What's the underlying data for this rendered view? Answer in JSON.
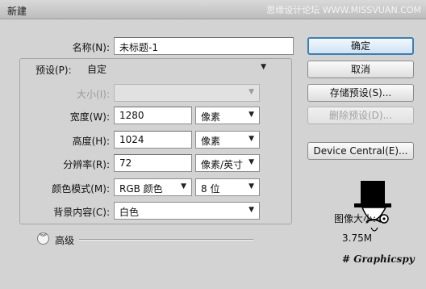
{
  "window": {
    "title": "新建",
    "watermark": "思缘设计论坛  WWW.MISSVUAN.COM"
  },
  "form": {
    "name": {
      "label": "名称(N):",
      "value": "未标题-1"
    },
    "preset": {
      "label": "预设(P):",
      "value": "自定"
    },
    "size": {
      "label": "大小(I):",
      "value": ""
    },
    "width": {
      "label": "宽度(W):",
      "value": "1280",
      "unit": "像素"
    },
    "height": {
      "label": "高度(H):",
      "value": "1024",
      "unit": "像素"
    },
    "resolution": {
      "label": "分辨率(R):",
      "value": "72",
      "unit": "像素/英寸"
    },
    "color_mode": {
      "label": "颜色模式(M):",
      "value": "RGB 颜色",
      "depth": "8 位"
    },
    "background": {
      "label": "背景内容(C):",
      "value": "白色"
    },
    "advanced_label": "高级"
  },
  "buttons": {
    "ok": "确定",
    "cancel": "取消",
    "save_preset": "存储预设(S)...",
    "delete_preset": "删除预设(D)...",
    "device_central": "Device Central(E)..."
  },
  "image_size": {
    "label": "图像大小:",
    "value": "3.75M"
  },
  "brand_text": "# Graphicspy",
  "icons": {
    "dropdown": "chevron-down-icon",
    "advanced": "double-chevron-down-icon",
    "mascot": "top-hat-mascot-icon"
  },
  "colors": {
    "dialog_bg": "#d3d3d3",
    "primary_border": "#3c7fb1",
    "disabled_text": "#9a9a9a"
  }
}
